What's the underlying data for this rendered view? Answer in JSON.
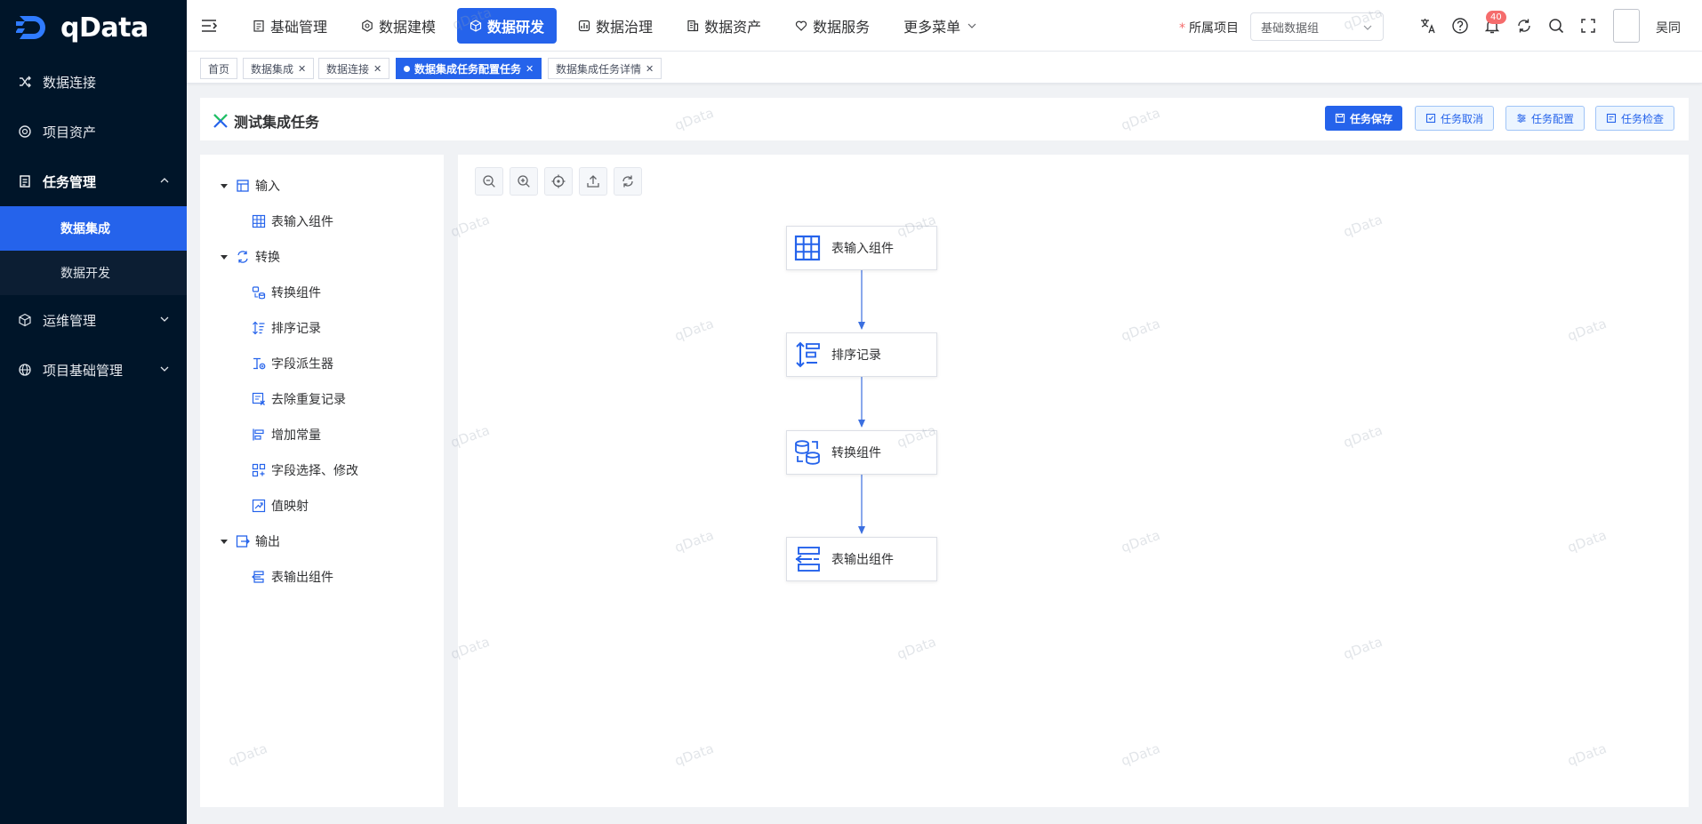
{
  "brand": {
    "name": "qData"
  },
  "sidebar": {
    "items": [
      {
        "label": "数据连接",
        "icon": "shuffle-icon"
      },
      {
        "label": "项目资产",
        "icon": "asset-icon"
      },
      {
        "label": "任务管理",
        "icon": "document-icon",
        "expanded": true,
        "children": [
          {
            "label": "数据集成",
            "active": true
          },
          {
            "label": "数据开发",
            "active": false
          }
        ]
      },
      {
        "label": "运维管理",
        "icon": "cube-icon"
      },
      {
        "label": "项目基础管理",
        "icon": "globe-icon"
      }
    ]
  },
  "topnav": {
    "items": [
      {
        "label": "基础管理",
        "icon": "clipboard-icon"
      },
      {
        "label": "数据建模",
        "icon": "hexagon-icon"
      },
      {
        "label": "数据研发",
        "icon": "box-icon",
        "active": true
      },
      {
        "label": "数据治理",
        "icon": "chart-box-icon"
      },
      {
        "label": "数据资产",
        "icon": "building-icon"
      },
      {
        "label": "数据服务",
        "icon": "heart-icon"
      },
      {
        "label": "更多菜单",
        "icon": ""
      }
    ],
    "project_label": "所属项目",
    "project_value": "基础数据组",
    "notification_count": "40",
    "user_name": "吴同"
  },
  "tags": [
    {
      "label": "首页",
      "closable": false,
      "active": false
    },
    {
      "label": "数据集成",
      "closable": true,
      "active": false
    },
    {
      "label": "数据连接",
      "closable": true,
      "active": false
    },
    {
      "label": "数据集成任务配置任务",
      "closable": true,
      "active": true
    },
    {
      "label": "数据集成任务详情",
      "closable": true,
      "active": false
    }
  ],
  "task": {
    "title": "测试集成任务",
    "buttons": [
      {
        "label": "任务保存",
        "primary": true
      },
      {
        "label": "任务取消",
        "primary": false
      },
      {
        "label": "任务配置",
        "primary": false
      },
      {
        "label": "任务检查",
        "primary": false
      }
    ]
  },
  "tree": {
    "groups": [
      {
        "label": "输入",
        "children": [
          "表输入组件"
        ]
      },
      {
        "label": "转换",
        "children": [
          "转换组件",
          "排序记录",
          "字段派生器",
          "去除重复记录",
          "增加常量",
          "字段选择、修改",
          "值映射"
        ]
      },
      {
        "label": "输出",
        "children": [
          "表输出组件"
        ]
      }
    ]
  },
  "flow": {
    "nodes": [
      {
        "label": "表输入组件",
        "icon": "table-grid-icon"
      },
      {
        "label": "排序记录",
        "icon": "sort-icon"
      },
      {
        "label": "转换组件",
        "icon": "database-transform-icon"
      },
      {
        "label": "表输出组件",
        "icon": "table-output-icon"
      }
    ]
  },
  "colors": {
    "accent": "#2563eb",
    "sidebar": "#001529"
  },
  "watermark": "qData"
}
